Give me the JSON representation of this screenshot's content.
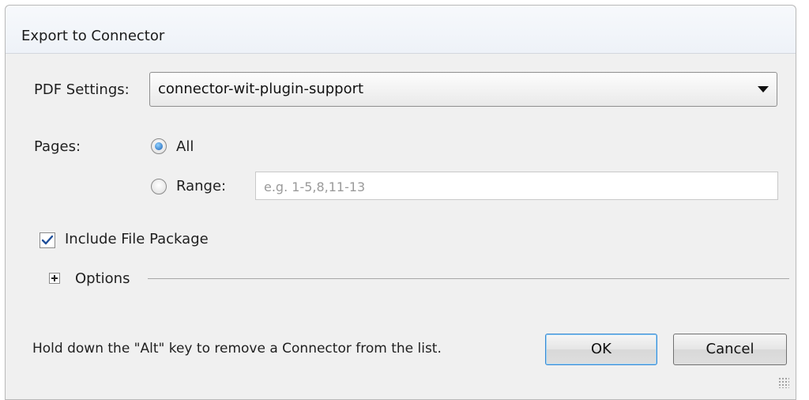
{
  "window": {
    "title": "Export to Connector"
  },
  "pdf_settings": {
    "label": "PDF Settings:",
    "selected": "connector-wit-plugin-support"
  },
  "pages": {
    "label": "Pages:",
    "all_label": "All",
    "range_label": "Range:",
    "range_value": "",
    "range_placeholder": "e.g. 1-5,8,11-13",
    "selected": "All"
  },
  "include_file_package": {
    "label": "Include File Package",
    "checked": true
  },
  "options": {
    "label": "Options",
    "expanded": false
  },
  "footer": {
    "hint": "Hold down the \"Alt\" key to remove a Connector from the list."
  },
  "buttons": {
    "ok": "OK",
    "cancel": "Cancel"
  },
  "colors": {
    "dialog_bg": "#f0f0f0",
    "ok_focus_border": "#3a8ad3",
    "radio_selected": "#1a5fb4"
  }
}
